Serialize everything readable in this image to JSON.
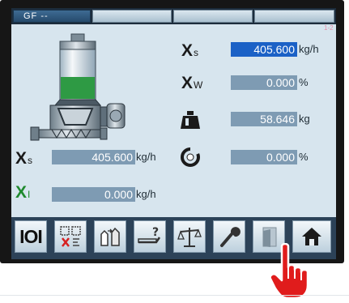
{
  "tabs": {
    "active_label": "GF --",
    "count": 5
  },
  "page_indicator": "1-2",
  "readouts": {
    "xs_setpoint": {
      "symbol": "X",
      "sub": "s",
      "value": "405.600",
      "unit": "kg/h"
    },
    "xw": {
      "symbol": "X",
      "sub": "W",
      "value": "0.000",
      "unit": "%"
    },
    "weight": {
      "value": "58.646",
      "unit": "kg"
    },
    "speed": {
      "value": "0.000",
      "unit": "%"
    },
    "xs_actual": {
      "symbol": "X",
      "sub": "s",
      "value": "405.600",
      "unit": "kg/h"
    },
    "xi": {
      "symbol": "X",
      "sub": "I",
      "value": "0.000",
      "unit": "kg/h"
    }
  },
  "bottom_bar": {
    "io_label": "IOI"
  },
  "colors": {
    "screen_bg": "#d7e5ee",
    "value_field": "#7e9bb3",
    "value_selected": "#1b61c6",
    "symbol_xs": "#1a1a1a",
    "symbol_xi": "#1f8a2e",
    "hopper_fill": "#2e9a44",
    "pointer_hand": "#e01c1c"
  },
  "hopper_level": 0.45
}
